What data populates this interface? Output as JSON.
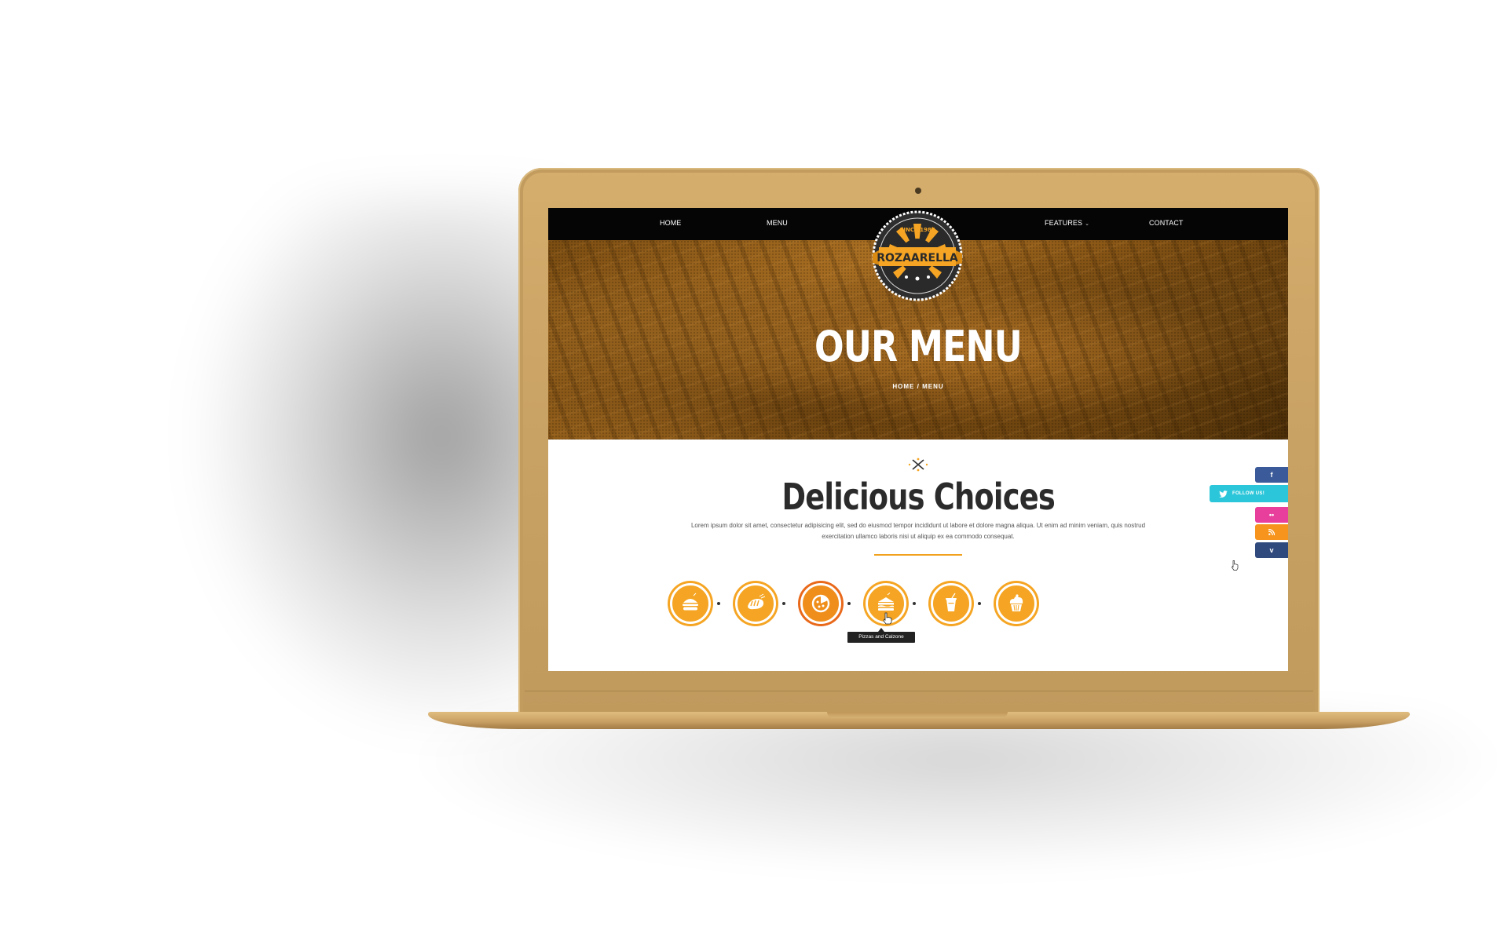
{
  "nav": {
    "home": "HOME",
    "menu": "MENU",
    "features": "FEATURES",
    "contact": "CONTACT"
  },
  "logo": {
    "name": "ROZAARELLA",
    "since": "SINCE 1985"
  },
  "hero": {
    "title": "OUR MENU",
    "breadcrumb_home": "HOME",
    "breadcrumb_sep": "/",
    "breadcrumb_current": "MENU"
  },
  "section": {
    "title": "Delicious Choices",
    "lead": "Lorem ipsum dolor sit amet, consectetur adipisicing elit, sed do eiusmod tempor incididunt ut labore et dolore magna aliqua. Ut enim ad minim veniam, quis nostrud exercitation ullamco laboris nisi ut aliquip ex ea commodo consequat."
  },
  "categories": [
    {
      "icon": "burger-icon"
    },
    {
      "icon": "bread-icon"
    },
    {
      "icon": "pizza-icon",
      "active": true
    },
    {
      "icon": "sandwich-icon"
    },
    {
      "icon": "drink-icon"
    },
    {
      "icon": "cupcake-icon"
    }
  ],
  "tooltip": "Pizzas and Calzone",
  "social": {
    "facebook": "f",
    "twitter_label": "FOLLOW US!",
    "flickr": "••",
    "vimeo": "v"
  },
  "colors": {
    "accent": "#f5a523",
    "laptop_gold": "#c9a265",
    "facebook": "#3a5a99",
    "twitter": "#2bc6d9",
    "flickr": "#e83e9c",
    "rss": "#f7941d",
    "vimeo": "#314a7e"
  }
}
